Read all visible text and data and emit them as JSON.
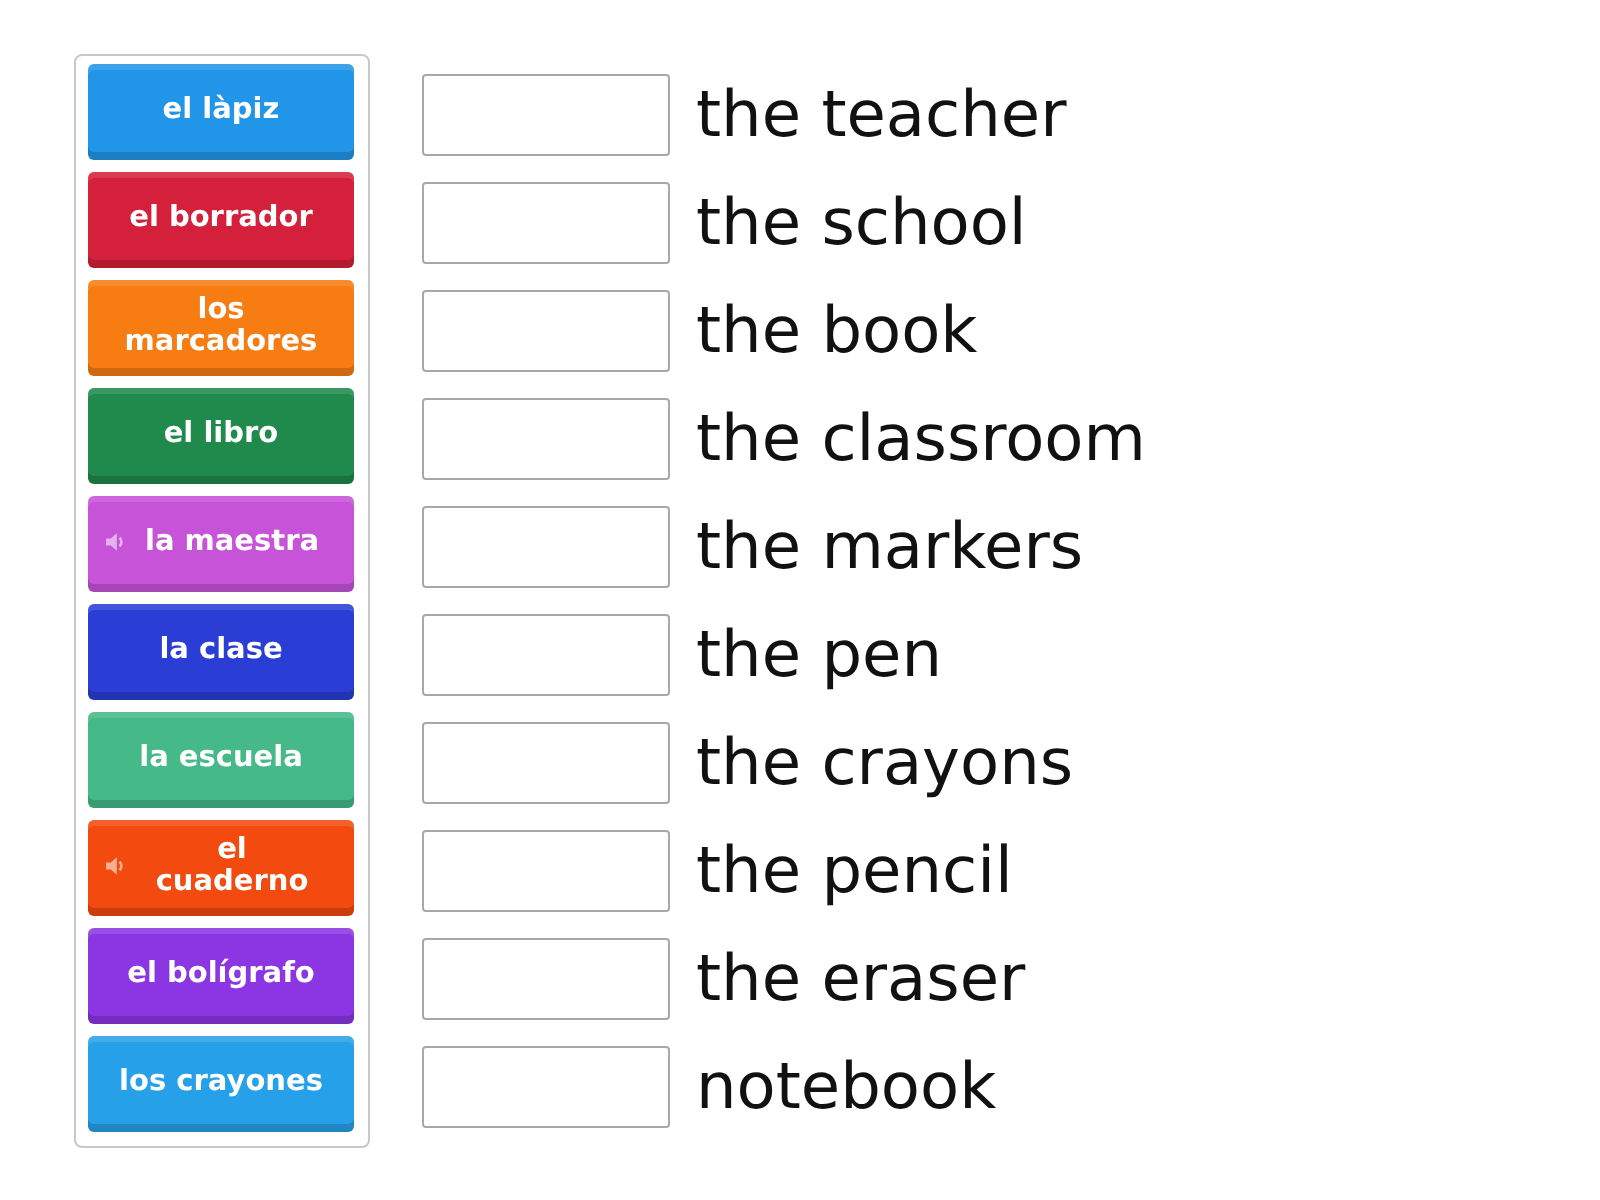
{
  "tiles": [
    {
      "label": "el làpiz",
      "color": "#2196e8",
      "audio": false
    },
    {
      "label": "el borrador",
      "color": "#d4203a",
      "audio": false
    },
    {
      "label": "los marcadores",
      "color": "#f77c12",
      "audio": false
    },
    {
      "label": "el libro",
      "color": "#1f8a4c",
      "audio": false
    },
    {
      "label": "la maestra",
      "color": "#c653d8",
      "audio": true
    },
    {
      "label": "la clase",
      "color": "#2a3ed6",
      "audio": false
    },
    {
      "label": "la escuela",
      "color": "#45b987",
      "audio": false
    },
    {
      "label": "el cuaderno",
      "color": "#f24a0f",
      "audio": true
    },
    {
      "label": "el bolígrafo",
      "color": "#8b36e2",
      "audio": false
    },
    {
      "label": "los crayones",
      "color": "#27a0ea",
      "audio": false
    }
  ],
  "prompts": [
    "the teacher",
    "the school",
    "the book",
    "the classroom",
    "the markers",
    "the pen",
    "the crayons",
    "the pencil",
    "the eraser",
    "notebook"
  ]
}
